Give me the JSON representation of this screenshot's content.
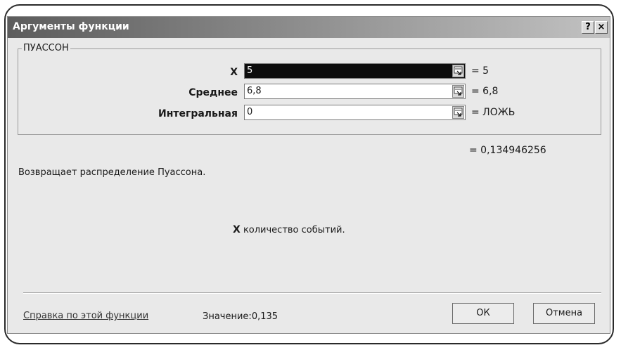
{
  "dialog": {
    "title": "Аргументы функции",
    "help_button": "?",
    "close_button": "×"
  },
  "function_group": {
    "name": "ПУАССОН",
    "args": [
      {
        "label": "X",
        "value": "5",
        "result": "= 5",
        "active": true
      },
      {
        "label": "Среднее",
        "value": "6,8",
        "result": "= 6,8",
        "active": false
      },
      {
        "label": "Интегральная",
        "value": "0",
        "result": "= ЛОЖЬ",
        "active": false
      }
    ]
  },
  "formula_result": "= 0,134946256",
  "description": "Возвращает распределение Пуассона.",
  "arg_description": {
    "name": "X",
    "text": "количество событий."
  },
  "footer": {
    "help_link": "Справка по этой функции",
    "value_label": "Значение:",
    "value": "0,135",
    "ok_label": "ОК",
    "cancel_label": "Отмена"
  },
  "icons": {
    "collapse": "collapse-dialog-icon"
  }
}
